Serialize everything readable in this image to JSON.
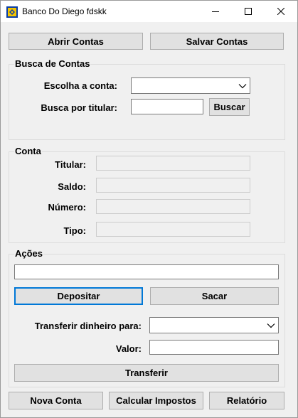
{
  "window": {
    "title": "Banco Do Diego fdskk",
    "icons": {
      "app": "bank-app-icon",
      "minimize": "minimize-icon",
      "maximize": "maximize-icon",
      "close": "close-icon"
    }
  },
  "toolbar": {
    "open_label": "Abrir Contas",
    "save_label": "Salvar Contas"
  },
  "busca": {
    "title": "Busca de Contas",
    "choose_label": "Escolha a conta:",
    "choose_value": "",
    "holder_label": "Busca por titular:",
    "holder_value": "",
    "search_label": "Buscar"
  },
  "conta": {
    "title": "Conta",
    "titular_label": "Titular:",
    "titular_value": "",
    "saldo_label": "Saldo:",
    "saldo_value": "",
    "numero_label": "Número:",
    "numero_value": "",
    "tipo_label": "Tipo:",
    "tipo_value": ""
  },
  "acoes": {
    "title": "Ações",
    "amount_value": "",
    "deposit_label": "Depositar",
    "withdraw_label": "Sacar",
    "transfer_to_label": "Transferir dinheiro para:",
    "transfer_to_value": "",
    "valor_label": "Valor:",
    "valor_value": "",
    "transfer_label": "Transferir"
  },
  "footer": {
    "new_account_label": "Nova Conta",
    "taxes_label": "Calcular Impostos",
    "report_label": "Relatório"
  },
  "colors": {
    "focus_border": "#0078d7",
    "button_bg": "#e1e1e1",
    "window_bg": "#f0f0f0"
  }
}
